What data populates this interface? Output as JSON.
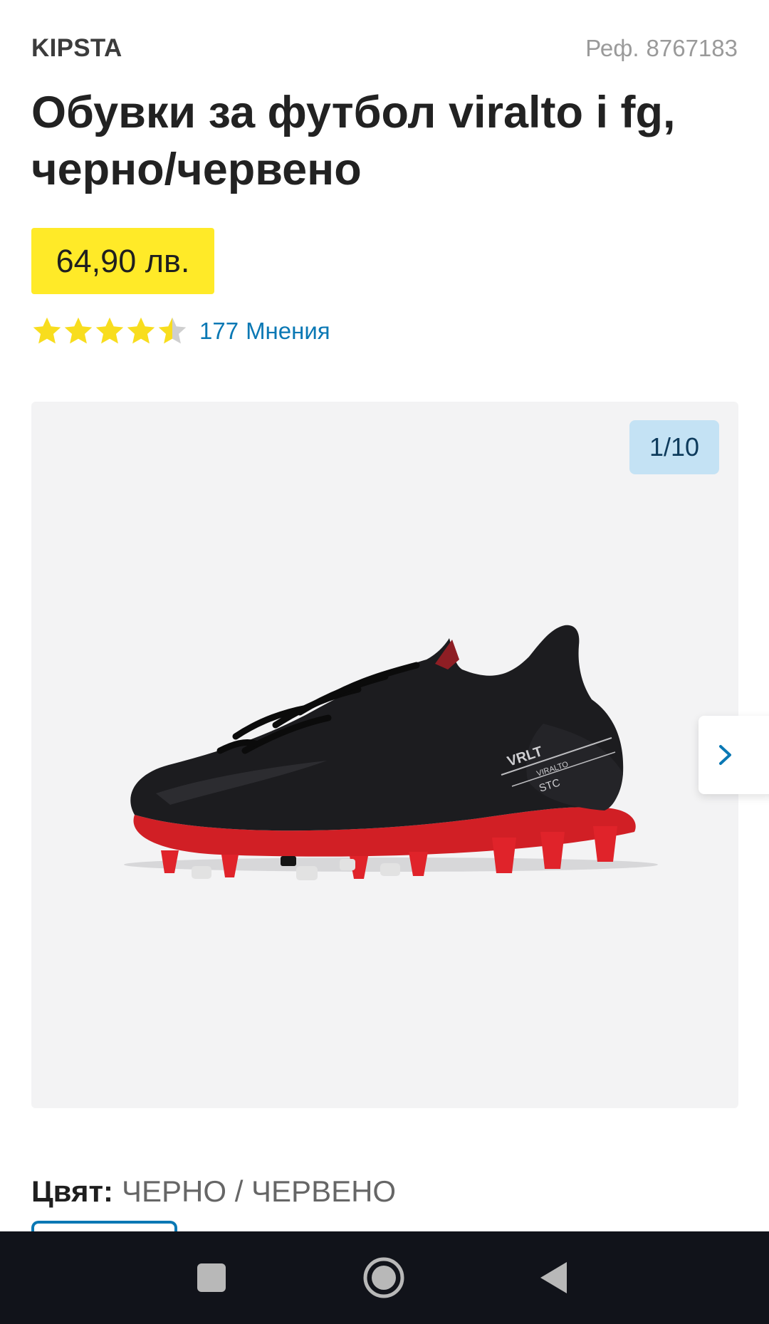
{
  "product": {
    "brand": "KIPSTA",
    "ref_label": "Реф.",
    "ref_number": "8767183",
    "title_line1": "Обувки за футбол viralto i fg,",
    "title_line2": "черно/червено",
    "price": "64,90 лв.",
    "rating_value": 4.5,
    "rating_max": 5,
    "review_count": "177",
    "review_label": "Мнения"
  },
  "gallery": {
    "counter": "1/10",
    "current": 1,
    "total": 10,
    "image_icon": "football-boot-image",
    "next_icon": "chevron-right-icon"
  },
  "variant": {
    "color_label": "Цвят:",
    "color_value": "ЧЕРНО / ЧЕРВЕНО"
  },
  "system_nav": {
    "recents_icon": "square-recents-icon",
    "home_icon": "circle-home-icon",
    "back_icon": "triangle-back-icon"
  },
  "colors": {
    "price_bg": "#ffea28",
    "star": "#f8dd1e",
    "link": "#0a78b4",
    "counter_bg": "#c4e2f4",
    "gallery_bg": "#f3f3f4",
    "nav_bg": "#11131a"
  }
}
